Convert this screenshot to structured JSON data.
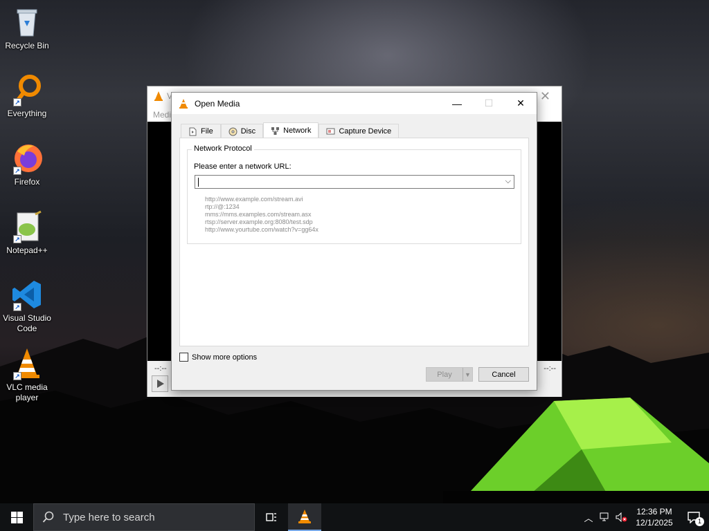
{
  "desktop": {
    "icons": [
      {
        "label": "Recycle Bin",
        "icon": "recycle-bin-icon"
      },
      {
        "label": "Everything",
        "icon": "everything-search-icon"
      },
      {
        "label": "Firefox",
        "icon": "firefox-icon"
      },
      {
        "label": "Notepad++",
        "icon": "notepadpp-icon"
      },
      {
        "label": "Visual Studio Code",
        "icon": "vscode-icon"
      },
      {
        "label": "VLC media player",
        "icon": "vlc-icon"
      }
    ]
  },
  "vlc_main": {
    "title_initial": "V",
    "menu_initial": "Medi",
    "time_left": "--:--",
    "time_right": "--:--"
  },
  "dialog": {
    "title": "Open Media",
    "tabs": [
      {
        "label": "File",
        "icon": "file-icon",
        "active": false
      },
      {
        "label": "Disc",
        "icon": "disc-icon",
        "active": false
      },
      {
        "label": "Network",
        "icon": "network-icon",
        "active": true
      },
      {
        "label": "Capture Device",
        "icon": "capture-device-icon",
        "active": false
      }
    ],
    "group_label": "Network Protocol",
    "url_label": "Please enter a network URL:",
    "url_value": "",
    "examples": [
      "http://www.example.com/stream.avi",
      "rtp://@:1234",
      "mms://mms.examples.com/stream.asx",
      "rtsp://server.example.org:8080/test.sdp",
      "http://www.yourtube.com/watch?v=gg64x"
    ],
    "show_more_options": "Show more options",
    "show_more_checked": false,
    "play_label": "Play",
    "cancel_label": "Cancel"
  },
  "taskbar": {
    "search_placeholder": "Type here to search",
    "time": "12:36 PM",
    "date": "12/1/2025",
    "notification_count": "1"
  },
  "colors": {
    "vlc_orange": "#f08a00",
    "accent_blue": "#78a9e8",
    "tent_green": "#8ee33a"
  }
}
